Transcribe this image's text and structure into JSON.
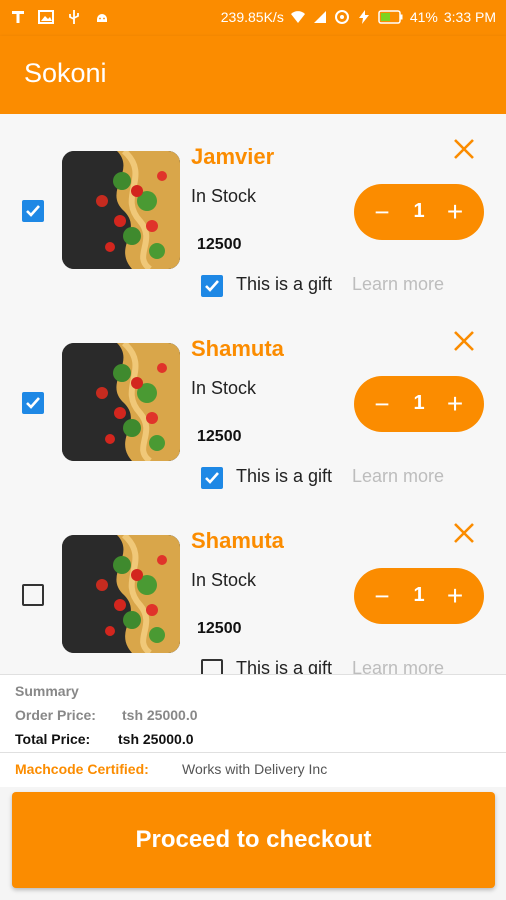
{
  "status_bar": {
    "network_speed": "239.85K/s",
    "battery": "41%",
    "time": "3:33 PM"
  },
  "app_bar": {
    "title": "Sokoni"
  },
  "cart": {
    "items": [
      {
        "name": "Jamvier",
        "stock": "In Stock",
        "price": "12500",
        "quantity": "1",
        "selected": true,
        "gift": true,
        "gift_label": "This is a gift",
        "learn_more": "Learn more"
      },
      {
        "name": "Shamuta",
        "stock": "In Stock",
        "price": "12500",
        "quantity": "1",
        "selected": true,
        "gift": true,
        "gift_label": "This is a gift",
        "learn_more": "Learn more"
      },
      {
        "name": "Shamuta",
        "stock": "In Stock",
        "price": "12500",
        "quantity": "1",
        "selected": false,
        "gift": false,
        "gift_label": "This is a gift",
        "learn_more": "Learn more"
      }
    ],
    "decrement_symbol": "−",
    "increment_symbol": "+",
    "remove_icon": "close-icon"
  },
  "summary": {
    "title": "Summary",
    "order_price_label": "Order Price:",
    "order_price_value": "tsh 25000.0",
    "total_price_label": "Total Price:",
    "total_price_value": "tsh 25000.0"
  },
  "certification": {
    "label": "Machcode Certified:",
    "value": "Works with Delivery Inc"
  },
  "checkout": {
    "label": "Proceed to checkout"
  },
  "colors": {
    "accent": "#fb8c00",
    "checkbox": "#1e88e5"
  }
}
